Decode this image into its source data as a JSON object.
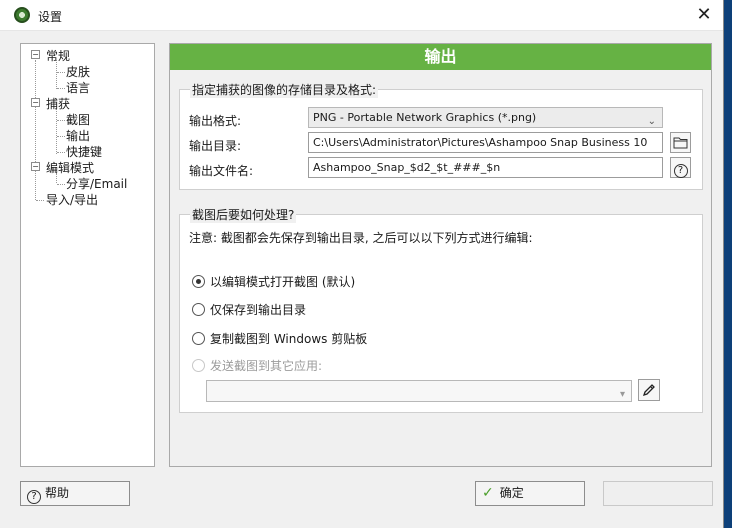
{
  "window": {
    "title": "设置",
    "close_glyph": "✕"
  },
  "nav": {
    "general": "常规",
    "skin": "皮肤",
    "language": "语言",
    "capture": "捕获",
    "screenshot": "截图",
    "output": "输出",
    "hotkeys": "快捷键",
    "edit_mode": "编辑模式",
    "share_email": "分享/Email",
    "import_export": "导入/导出"
  },
  "content": {
    "header": "输出",
    "storage": {
      "title": "指定捕获的图像的存储目录及格式:",
      "format_label": "输出格式:",
      "format_value": "PNG - Portable Network Graphics (*.png)",
      "dir_label": "输出目录:",
      "dir_value": "C:\\Users\\Administrator\\Pictures\\Ashampoo Snap Business 10",
      "filename_label": "输出文件名:",
      "filename_value": "Ashampoo_Snap_$d2_$t_###_$n"
    },
    "after": {
      "title": "截图后要如何处理?",
      "note": "注意: 截图都会先保存到输出目录, 之后可以以下列方式进行编辑:",
      "options": [
        {
          "label": "以编辑模式打开截图 (默认)",
          "state": "selected"
        },
        {
          "label": "仅保存到输出目录",
          "state": "unselected"
        },
        {
          "label": "复制截图到 Windows 剪贴板",
          "state": "unselected"
        },
        {
          "label": "发送截图到其它应用:",
          "state": "disabled"
        }
      ],
      "app_select_value": ""
    }
  },
  "footer": {
    "help": "帮助",
    "ok": "确定",
    "cancel": ""
  },
  "icons": {
    "folder": "folder-icon",
    "help": "help-icon",
    "edit": "pencil-icon",
    "check": "checkmark-icon"
  },
  "colors": {
    "header_green": "#66b244",
    "ok_check": "#4a9e2a"
  }
}
